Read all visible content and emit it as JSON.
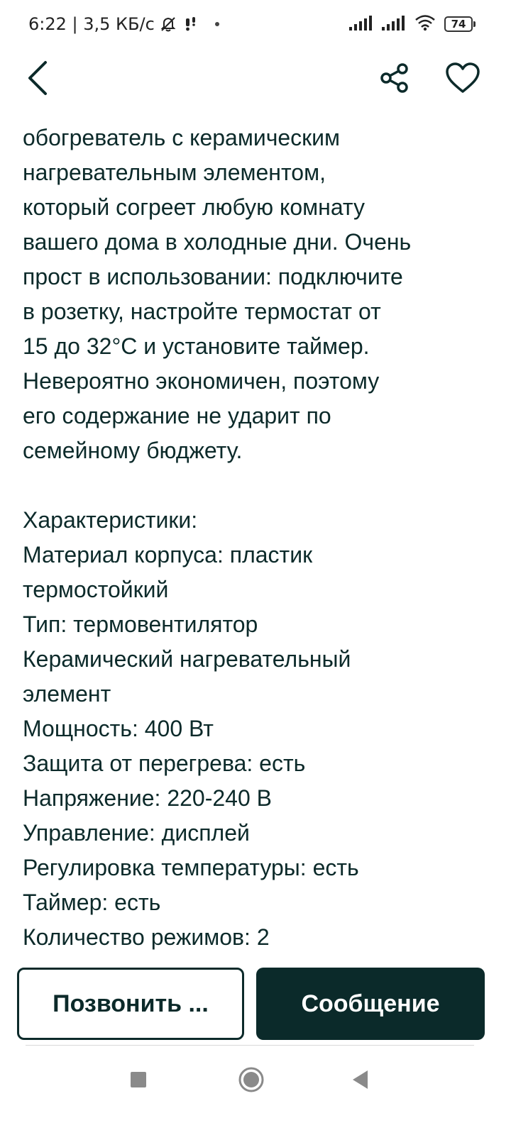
{
  "status_bar": {
    "time_speed": "6:22 | 3,5 КБ/с",
    "battery": "74",
    "icons": [
      "muted-bell-icon",
      "notification-icon",
      "dot-icon",
      "signal-icon",
      "signal-icon",
      "wifi-icon",
      "battery-icon"
    ]
  },
  "header": {
    "icons": [
      "back-arrow-icon",
      "share-icon",
      "heart-icon"
    ]
  },
  "description": {
    "text": "обогреватель с керамическим\nнагревательным элементом,\nкоторый согреет любую комнату\nвашего дома в холодные дни. Очень\nпрост в использовании: подключите\nв розетку, настройте термостат от\n15 до 32°С и установите таймер.\nНевероятно экономичен, поэтому\nего содержание не ударит по\nсемейному бюджету.\n\nХарактеристики:\nМатериал корпуса: пластик\nтермостойкий\nТип: термовентилятор\nКерамический нагревательный\nэлемент\nМощность: 400 Вт\nЗащита от перегрева: есть\nНапряжение: 220-240 В\nУправление: дисплей\nРегулировка температуры: есть\nТаймер: есть\nКоличество режимов: 2"
  },
  "actions": {
    "call_label": "Позвонить ...",
    "message_label": "Сообщение"
  },
  "colors": {
    "primary": "#0b2a2a",
    "text": "#0c2a2a",
    "background": "#ffffff"
  }
}
